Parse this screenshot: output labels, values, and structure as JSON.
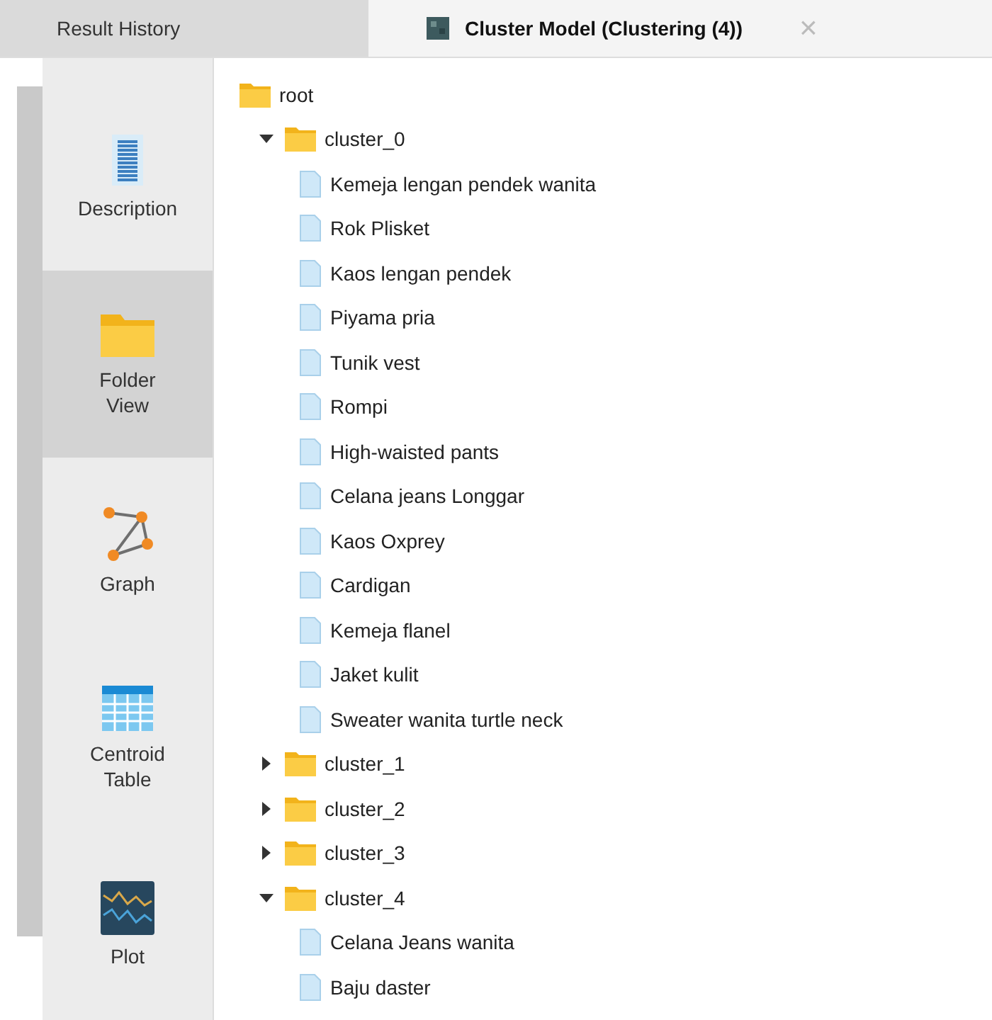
{
  "tabs": [
    {
      "label": "Result History",
      "selected": false
    },
    {
      "label": "Cluster Model (Clustering (4))",
      "selected": true,
      "close": "×"
    }
  ],
  "views": [
    {
      "label": "Description",
      "kind": "description",
      "selected": false
    },
    {
      "label": "Folder View",
      "kind": "folder",
      "selected": true
    },
    {
      "label": "Graph",
      "kind": "graph",
      "selected": false
    },
    {
      "label": "Centroid Table",
      "kind": "table",
      "selected": false
    },
    {
      "label": "Plot",
      "kind": "plot",
      "selected": false
    }
  ],
  "tree": {
    "label": "root",
    "kind": "folder",
    "children": [
      {
        "label": "cluster_0",
        "kind": "folder",
        "expanded": true,
        "children": [
          {
            "label": "Kemeja lengan pendek wanita",
            "kind": "file"
          },
          {
            "label": "Rok Plisket",
            "kind": "file"
          },
          {
            "label": "Kaos lengan pendek",
            "kind": "file"
          },
          {
            "label": "Piyama pria",
            "kind": "file"
          },
          {
            "label": "Tunik vest",
            "kind": "file"
          },
          {
            "label": "Rompi",
            "kind": "file"
          },
          {
            "label": "High-waisted pants",
            "kind": "file"
          },
          {
            "label": "Celana jeans Longgar",
            "kind": "file"
          },
          {
            "label": "Kaos Oxprey",
            "kind": "file"
          },
          {
            "label": "Cardigan",
            "kind": "file"
          },
          {
            "label": "Kemeja flanel",
            "kind": "file"
          },
          {
            "label": "Jaket kulit",
            "kind": "file"
          },
          {
            "label": "Sweater wanita turtle neck",
            "kind": "file"
          }
        ]
      },
      {
        "label": "cluster_1",
        "kind": "folder",
        "expanded": false
      },
      {
        "label": "cluster_2",
        "kind": "folder",
        "expanded": false
      },
      {
        "label": "cluster_3",
        "kind": "folder",
        "expanded": false
      },
      {
        "label": "cluster_4",
        "kind": "folder",
        "expanded": true,
        "children": [
          {
            "label": "Celana Jeans wanita",
            "kind": "file"
          },
          {
            "label": "Baju daster",
            "kind": "file"
          }
        ]
      }
    ]
  }
}
